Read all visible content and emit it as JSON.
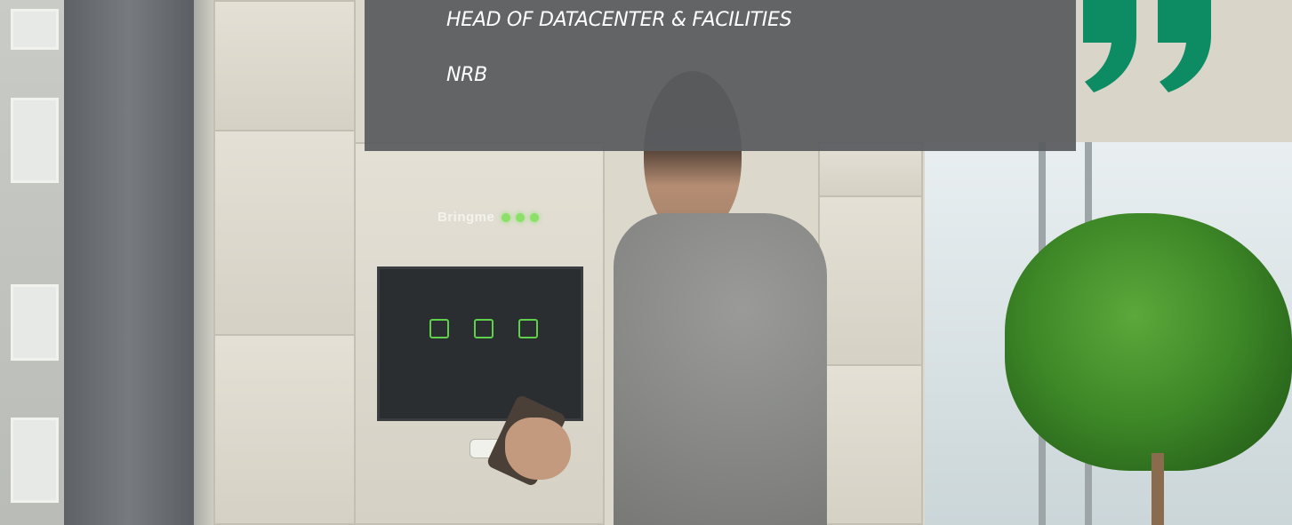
{
  "testimonial": {
    "title": "HEAD OF DATACENTER & FACILITIES",
    "company": "NRB"
  },
  "locker": {
    "brand": "Bringme"
  },
  "colors": {
    "overlay": "#5a5c60",
    "quote_icon": "#0d8c63",
    "text": "#ffffff"
  },
  "icons": {
    "quote": "closing-quote-icon"
  }
}
